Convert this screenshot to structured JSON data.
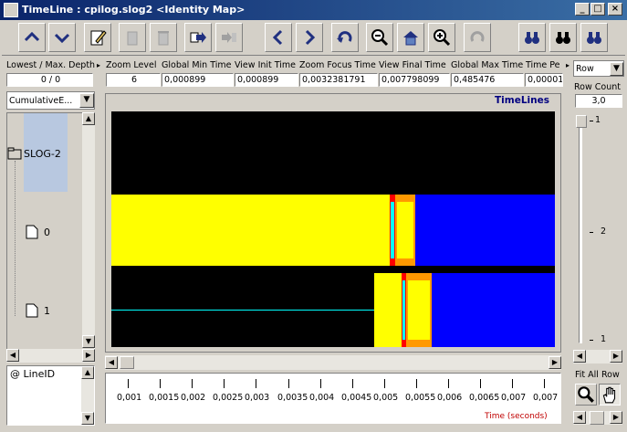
{
  "window": {
    "title": "TimeLine : cpilog.slog2  <Identity Map>",
    "min": "_",
    "max": "□",
    "close": "×"
  },
  "fields": {
    "depth": {
      "label": "Lowest / Max. Depth",
      "value": "0 / 0"
    },
    "zoom_level": {
      "label": "Zoom Level",
      "value": "6"
    },
    "global_min": {
      "label": "Global Min Time",
      "value": "0,000899"
    },
    "view_init": {
      "label": "View  Init Time",
      "value": "0,000899"
    },
    "zoom_focus": {
      "label": "Zoom Focus Time",
      "value": "0,0032381791"
    },
    "view_final": {
      "label": "View  Final Time",
      "value": "0,007798099"
    },
    "global_max": {
      "label": "Global Max Time",
      "value": "0,485476"
    },
    "time_per": {
      "label": "Time  Pe",
      "value": "0,00001"
    }
  },
  "left": {
    "combo": "CumulativeE...",
    "tree_root": "SLOG-2",
    "tree_items": [
      "0",
      "1"
    ],
    "lineid": "@ LineID"
  },
  "canvas": {
    "title": "TimeLines",
    "axis_label": "Time (seconds)"
  },
  "right": {
    "row_combo": "Row",
    "row_count_label": "Row Count",
    "row_count": "3,0",
    "scale_ticks": [
      "1",
      "2",
      "1"
    ],
    "fit_label": "Fit All Row"
  },
  "ruler": {
    "ticks": [
      "0,001",
      "0,0015",
      "0,002",
      "0,0025",
      "0,003",
      "0,0035",
      "0,004",
      "0,0045",
      "0,005",
      "0,0055",
      "0,006",
      "0,0065",
      "0,007",
      "0,007"
    ]
  },
  "colors": {
    "bg": "#d4d0c8",
    "title": "#0a246a",
    "yellow": "#ffff00",
    "blue": "#0000ff",
    "orange": "#ff9900",
    "red": "#ff0000",
    "cyan": "#00ffff"
  }
}
